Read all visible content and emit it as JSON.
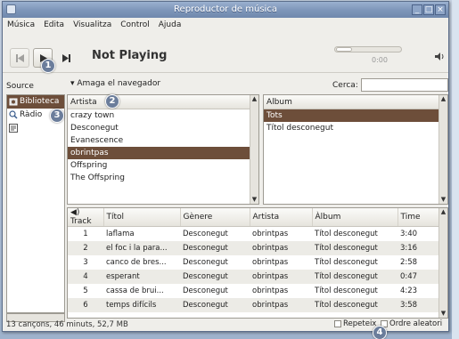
{
  "window": {
    "title": "Reproductor de música"
  },
  "menu": [
    "Música",
    "Edita",
    "Visualitza",
    "Control",
    "Ajuda"
  ],
  "player": {
    "now_playing": "Not Playing",
    "time": "0:00",
    "progress": 0.0
  },
  "browser": {
    "source_label": "Source",
    "hide_browser_label": "Amaga el navegador",
    "search_label": "Cerca:",
    "search_value": ""
  },
  "sidebar": {
    "items": [
      {
        "label": "Biblioteca",
        "icon": "library-icon",
        "selected": true
      },
      {
        "label": "Ràdio",
        "icon": "radio-icon",
        "selected": false
      },
      {
        "label": "",
        "icon": "playlist-icon",
        "selected": false
      }
    ]
  },
  "artists": {
    "header": "Artista",
    "rows": [
      "crazy town",
      "Desconegut",
      "Evanescence",
      "obrintpas",
      "Offspring",
      "The Offspring"
    ],
    "selected_index": 3
  },
  "albums": {
    "header": "Album",
    "rows": [
      "Tots",
      "Títol desconegut"
    ],
    "selected_index": 0
  },
  "tracks": {
    "columns": [
      "Track",
      "Títol",
      "Gènere",
      "Artista",
      "Àlbum",
      "Time"
    ],
    "rows": [
      [
        "1",
        "laflama",
        "Desconegut",
        "obrintpas",
        "Títol desconegut",
        "3:40"
      ],
      [
        "2",
        "el foc i la para...",
        "Desconegut",
        "obrintpas",
        "Títol desconegut",
        "3:16"
      ],
      [
        "3",
        "canco de bres...",
        "Desconegut",
        "obrintpas",
        "Títol desconegut",
        "2:58"
      ],
      [
        "4",
        "esperant",
        "Desconegut",
        "obrintpas",
        "Títol desconegut",
        "0:47"
      ],
      [
        "5",
        "cassa de brui...",
        "Desconegut",
        "obrintpas",
        "Títol desconegut",
        "4:23"
      ],
      [
        "6",
        "temps difícils",
        "Desconegut",
        "obrintpas",
        "Títol desconegut",
        "3:58"
      ]
    ]
  },
  "statusbar": {
    "summary": "13 cançons, 46 minuts, 52,7 MB",
    "repeat_label": "Repeteix",
    "shuffle_label": "Ordre aleatori"
  },
  "callouts": [
    "1",
    "2",
    "3",
    "4"
  ],
  "colors": {
    "selection": "#6d4e3a",
    "titlebar": "#7f97ba",
    "callout": "#6b7d9b"
  }
}
